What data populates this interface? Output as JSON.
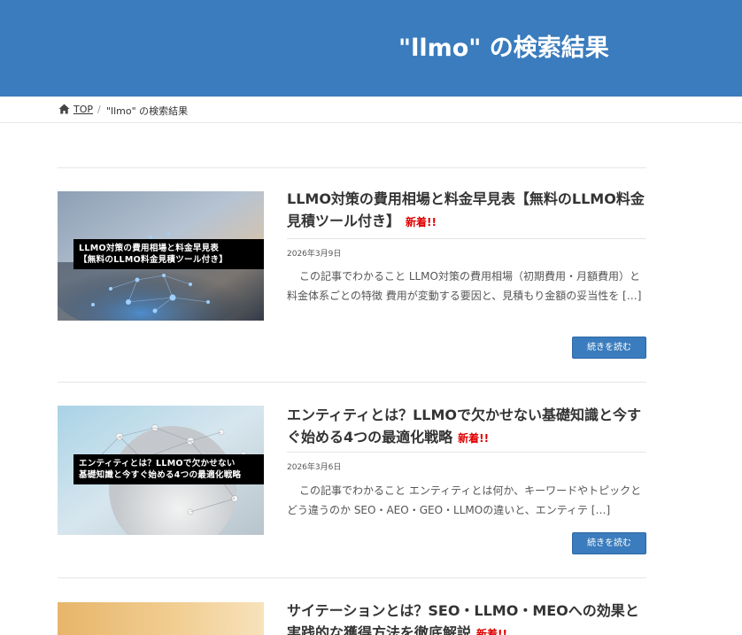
{
  "header": {
    "title": "\"llmo\" の検索結果"
  },
  "breadcrumb": {
    "home_icon": "home-icon",
    "top_label": "TOP",
    "separator": "/",
    "current": "\"llmo\" の検索結果"
  },
  "posts": [
    {
      "title": "LLMO対策の費用相場と料金早見表【無料のLLMO料金見積ツール付き】",
      "badge": "新着!!",
      "date": "2026年3月9日",
      "excerpt": "この記事でわかること LLMO対策の費用相場（初期費用・月額費用）と料金体系ごとの特徴 費用が変動する要因と、見積もり金額の妥当性を […]",
      "thumb_line1": "LLMO対策の費用相場と料金早見表",
      "thumb_line2": "【無料のLLMO料金見積ツール付き】",
      "more_label": "続きを読む"
    },
    {
      "title": "エンティティとは？LLMOで欠かせない基礎知識と今すぐ始める4つの最適化戦略",
      "badge": "新着!!",
      "date": "2026年3月6日",
      "excerpt": "この記事でわかること エンティティとは何か、キーワードやトピックとどう違うのか SEO・AEO・GEO・LLMOの違いと、エンティテ […]",
      "thumb_line1": "エンティティとは？LLMOで欠かせない",
      "thumb_line2": "基礎知識と今すぐ始める4つの最適化戦略",
      "more_label": "続きを読む"
    },
    {
      "title": "サイテーションとは？SEO・LLMO・MEOへの効果と実践的な獲得方法を徹底解説",
      "badge": "新着!!"
    }
  ]
}
